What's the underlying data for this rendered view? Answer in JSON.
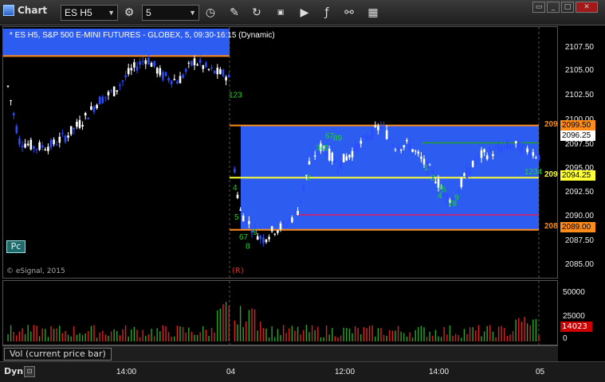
{
  "toolbar": {
    "title": "Chart",
    "symbol": "ES H5",
    "interval": "5",
    "icons": [
      "gear-icon",
      "clock-icon",
      "pencil-icon",
      "refresh-icon",
      "gif-icon",
      "play-icon",
      "formula-icon",
      "link-icon",
      "grid-icon"
    ]
  },
  "chart": {
    "title": "* ES H5, S&P 500 E-MINI FUTURES - GLOBEX, 5, 09:30-16:15 (Dynamic)",
    "pc_label": "Pc",
    "copyright": "© eSignal, 2015",
    "marker": "(R)"
  },
  "price_axis": {
    "ticks": [
      "2107.50",
      "2105.00",
      "2102.50",
      "2100.00",
      "2097.50",
      "2095.00",
      "2092.50",
      "2090.00",
      "2087.50",
      "2085.00"
    ],
    "labels": [
      {
        "text": "2099.50",
        "bg": "#ff8c1a",
        "fg": "#000",
        "price": 2099.5
      },
      {
        "text": "2096.25",
        "bg": "#ffffff",
        "fg": "#000",
        "price": 2096.25
      },
      {
        "text": "2094.25",
        "bg": "#ffff33",
        "fg": "#000",
        "price": 2094.25
      },
      {
        "text": "2089.00",
        "bg": "#ff8c1a",
        "fg": "#000",
        "price": 2089.0
      }
    ],
    "cut_labels": [
      {
        "text": "209",
        "color": "#ff8c1a",
        "price": 2099.5
      },
      {
        "text": "209",
        "color": "#ffff33",
        "price": 2094.25
      },
      {
        "text": "208",
        "color": "#ff8c1a",
        "price": 2089.0
      }
    ]
  },
  "volume": {
    "ticks": [
      "50000",
      "25000",
      "0"
    ],
    "current": "14023",
    "caption": "Vol (current price bar)"
  },
  "time_axis": {
    "mode": "Dyn",
    "ticks": [
      "14:00",
      "04",
      "12:00",
      "14:00",
      "05"
    ]
  },
  "colors": {
    "value_area": "#2d5cf0",
    "orange_line": "#ff8c1a",
    "yellow_line": "#ffff33",
    "up_bar": "#ffffff",
    "down_bar": "#2b4cff",
    "vol_up": "#2aa52a",
    "vol_down": "#e02020"
  },
  "chart_data": {
    "type": "candlestick",
    "y_range": [
      2084.25,
      2109.25
    ],
    "value_area_day1": {
      "high": 2109.25,
      "low": 2106.5
    },
    "value_area_day2": {
      "high": 2099.5,
      "low": 2089.0
    },
    "poc": 2094.25,
    "session_ref_lines": [
      2097.75,
      2090.5
    ],
    "profile_letters": [
      {
        "text": "123",
        "price": 2102.3
      },
      {
        "text": "4",
        "price": 2093.0
      },
      {
        "text": "5",
        "price": 2090.0
      },
      {
        "text": "67",
        "price": 2088.0
      },
      {
        "text": "8",
        "price": 2087.1
      },
      {
        "text": "9",
        "price": 2088.5
      },
      {
        "text": "2",
        "price": 2094.0
      },
      {
        "text": "345",
        "price": 2097.0
      },
      {
        "text": "67",
        "price": 2098.2
      },
      {
        "text": "89",
        "price": 2098.0
      },
      {
        "text": "1",
        "price": 2095.0
      },
      {
        "text": "2",
        "price": 2094.0
      },
      {
        "text": "3",
        "price": 2093.0
      },
      {
        "text": "4",
        "price": 2092.2
      },
      {
        "text": "5",
        "price": 2092.8
      },
      {
        "text": "78",
        "price": 2091.4
      },
      {
        "text": "9",
        "price": 2092.0
      },
      {
        "text": "1234",
        "price": 2094.6
      }
    ]
  }
}
